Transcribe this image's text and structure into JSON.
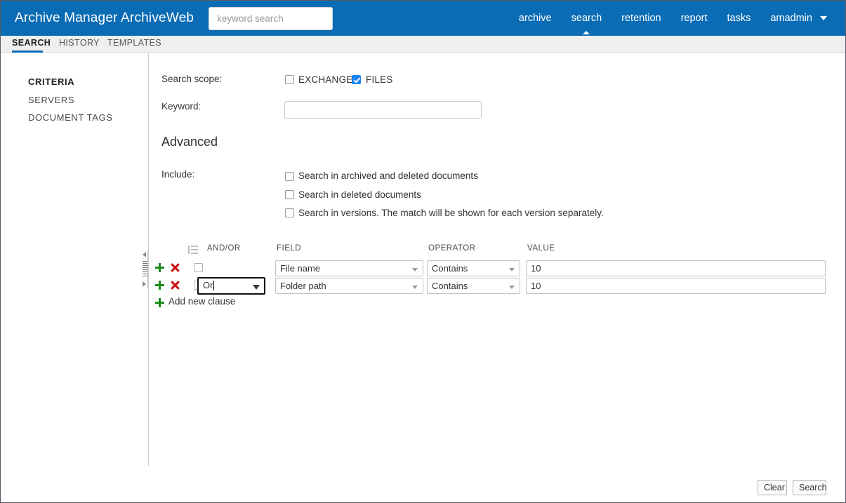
{
  "header": {
    "app_title": "Archive Manager ArchiveWeb",
    "search_placeholder": "keyword search",
    "search_value": "",
    "nav": [
      {
        "label": "archive",
        "active": false
      },
      {
        "label": "search",
        "active": true
      },
      {
        "label": "retention",
        "active": false
      },
      {
        "label": "report",
        "active": false
      },
      {
        "label": "tasks",
        "active": false
      },
      {
        "label": "amadmin",
        "active": false
      }
    ],
    "brand_color": "#0a6cb4"
  },
  "tabs": [
    {
      "label": "SEARCH",
      "active": true
    },
    {
      "label": "HISTORY",
      "active": false
    },
    {
      "label": "TEMPLATES",
      "active": false
    }
  ],
  "sidebar": {
    "items": [
      {
        "label": "CRITERIA",
        "active": true
      },
      {
        "label": "SERVERS",
        "active": false
      },
      {
        "label": "DOCUMENT TAGS",
        "active": false
      }
    ]
  },
  "main": {
    "scope_label": "Search scope:",
    "scope_options": [
      {
        "label": "EXCHANGE",
        "checked": false
      },
      {
        "label": "FILES",
        "checked": true
      }
    ],
    "keyword_label": "Keyword:",
    "keyword_value": "",
    "advanced_heading": "Advanced",
    "include_label": "Include:",
    "include_options": [
      {
        "label": "Search in archived and deleted documents",
        "checked": false
      },
      {
        "label": "Search in deleted documents",
        "checked": false
      },
      {
        "label": "Search in versions. The match will be shown for each version separately.",
        "checked": false
      }
    ],
    "grid": {
      "columns": {
        "andor": "AND/OR",
        "field": "FIELD",
        "operator": "OPERATOR",
        "value": "VALUE"
      },
      "rows": [
        {
          "selected": false,
          "andor": "",
          "andor_visible": false,
          "andor_focused": false,
          "field": "File name",
          "operator": "Contains",
          "value": "10"
        },
        {
          "selected": false,
          "andor": "Or",
          "andor_visible": true,
          "andor_focused": true,
          "field": "Folder path",
          "operator": "Contains",
          "value": "10"
        }
      ],
      "add_clause_label": "Add new clause"
    }
  },
  "footer": {
    "clear_label": "Clear",
    "search_label": "Search"
  },
  "colors": {
    "brand_blue": "#0a6cb4",
    "checkbox_blue": "#1a84f0",
    "add_green": "#1a8a1a",
    "remove_red": "#cc1111"
  }
}
